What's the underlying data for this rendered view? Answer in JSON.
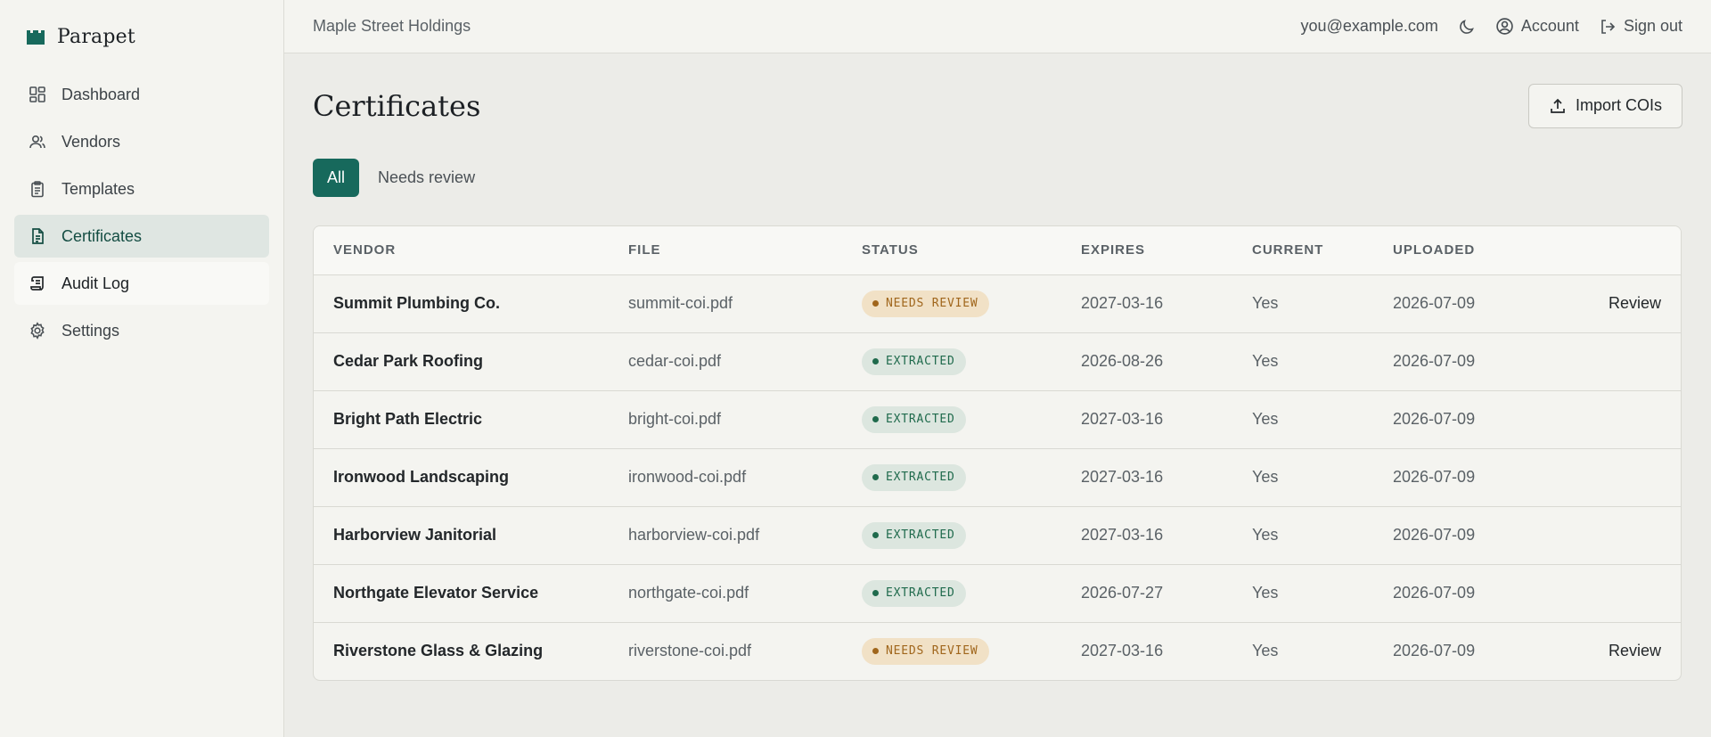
{
  "brand": {
    "name": "Parapet",
    "logo_color": "#17695c"
  },
  "sidebar": {
    "items": [
      {
        "label": "Dashboard",
        "icon": "dashboard-icon"
      },
      {
        "label": "Vendors",
        "icon": "users-icon"
      },
      {
        "label": "Templates",
        "icon": "clipboard-icon"
      },
      {
        "label": "Certificates",
        "icon": "document-icon",
        "active": true
      },
      {
        "label": "Audit Log",
        "icon": "scroll-icon"
      },
      {
        "label": "Settings",
        "icon": "gear-icon"
      }
    ]
  },
  "topbar": {
    "org_name": "Maple Street Holdings",
    "user_email": "you@example.com",
    "theme_icon": "moon-icon",
    "account_label": "Account",
    "signout_label": "Sign out"
  },
  "page": {
    "title": "Certificates",
    "import_label": "Import COIs",
    "filters": [
      {
        "label": "All",
        "active": true
      },
      {
        "label": "Needs review",
        "active": false
      }
    ]
  },
  "table": {
    "columns": [
      "VENDOR",
      "FILE",
      "STATUS",
      "EXPIRES",
      "CURRENT",
      "UPLOADED"
    ],
    "rows": [
      {
        "vendor": "Summit Plumbing Co.",
        "file": "summit-coi.pdf",
        "status": "NEEDS REVIEW",
        "status_kind": "review",
        "expires": "2027-03-16",
        "current": "Yes",
        "uploaded": "2026-07-09",
        "action": "Review"
      },
      {
        "vendor": "Cedar Park Roofing",
        "file": "cedar-coi.pdf",
        "status": "EXTRACTED",
        "status_kind": "extracted",
        "expires": "2026-08-26",
        "current": "Yes",
        "uploaded": "2026-07-09",
        "action": ""
      },
      {
        "vendor": "Bright Path Electric",
        "file": "bright-coi.pdf",
        "status": "EXTRACTED",
        "status_kind": "extracted",
        "expires": "2027-03-16",
        "current": "Yes",
        "uploaded": "2026-07-09",
        "action": ""
      },
      {
        "vendor": "Ironwood Landscaping",
        "file": "ironwood-coi.pdf",
        "status": "EXTRACTED",
        "status_kind": "extracted",
        "expires": "2027-03-16",
        "current": "Yes",
        "uploaded": "2026-07-09",
        "action": ""
      },
      {
        "vendor": "Harborview Janitorial",
        "file": "harborview-coi.pdf",
        "status": "EXTRACTED",
        "status_kind": "extracted",
        "expires": "2027-03-16",
        "current": "Yes",
        "uploaded": "2026-07-09",
        "action": ""
      },
      {
        "vendor": "Northgate Elevator Service",
        "file": "northgate-coi.pdf",
        "status": "EXTRACTED",
        "status_kind": "extracted",
        "expires": "2026-07-27",
        "current": "Yes",
        "uploaded": "2026-07-09",
        "action": ""
      },
      {
        "vendor": "Riverstone Glass & Glazing",
        "file": "riverstone-coi.pdf",
        "status": "NEEDS REVIEW",
        "status_kind": "review",
        "expires": "2027-03-16",
        "current": "Yes",
        "uploaded": "2026-07-09",
        "action": "Review"
      }
    ]
  }
}
